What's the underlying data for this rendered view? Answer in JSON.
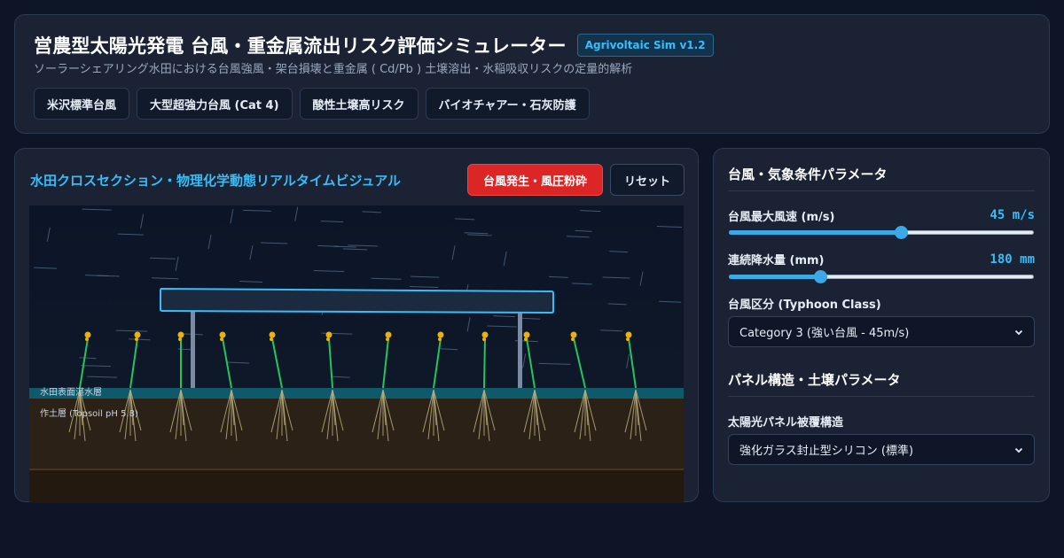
{
  "header": {
    "title": "営農型太陽光発電 台風・重金属流出リスク評価シミュレーター",
    "version": "Agrivoltaic Sim v1.2",
    "subtitle": "ソーラーシェアリング水田における台風強風・架台損壊と重金属 ( Cd/Pb ) 土壌溶出・水稲吸収リスクの定量的解析",
    "presets": [
      "米沢標準台風",
      "大型超強力台風 (Cat 4)",
      "酸性土壌高リスク",
      "バイオチャアー・石灰防護"
    ]
  },
  "viz": {
    "title": "水田クロスセクション・物理化学動態リアルタイムビジュアル",
    "typhoon_button": "台風発生・風圧粉砕",
    "reset_button": "リセット",
    "water_label": "水田表面湛水層",
    "soil_label": "作土層 (Topsoil pH 5.8)"
  },
  "params": {
    "section1_title": "台風・気象条件パラメータ",
    "wind": {
      "label": "台風最大風速 (m/s)",
      "value_text": "45 m/s",
      "value": 45,
      "min": 0,
      "max": 80
    },
    "rain": {
      "label": "連続降水量 (mm)",
      "value_text": "180 mm",
      "value": 180,
      "min": 0,
      "max": 600
    },
    "typhoon_class": {
      "label": "台風区分 (Typhoon Class)",
      "selected": "Category 3 (強い台風 - 45m/s)"
    },
    "section2_title": "パネル構造・土壌パラメータ",
    "panel": {
      "label": "太陽光パネル被覆構造",
      "selected": "強化ガラス封止型シリコン (標準)"
    }
  },
  "colors": {
    "accent": "#38bdf8",
    "danger": "#dc2626",
    "card_bg": "#1a2234",
    "page_bg": "#0e1526",
    "soil": "#2c2116",
    "water": "#0e5a6b",
    "rice_leaf": "#22c55e",
    "rice_grain": "#eab308"
  }
}
